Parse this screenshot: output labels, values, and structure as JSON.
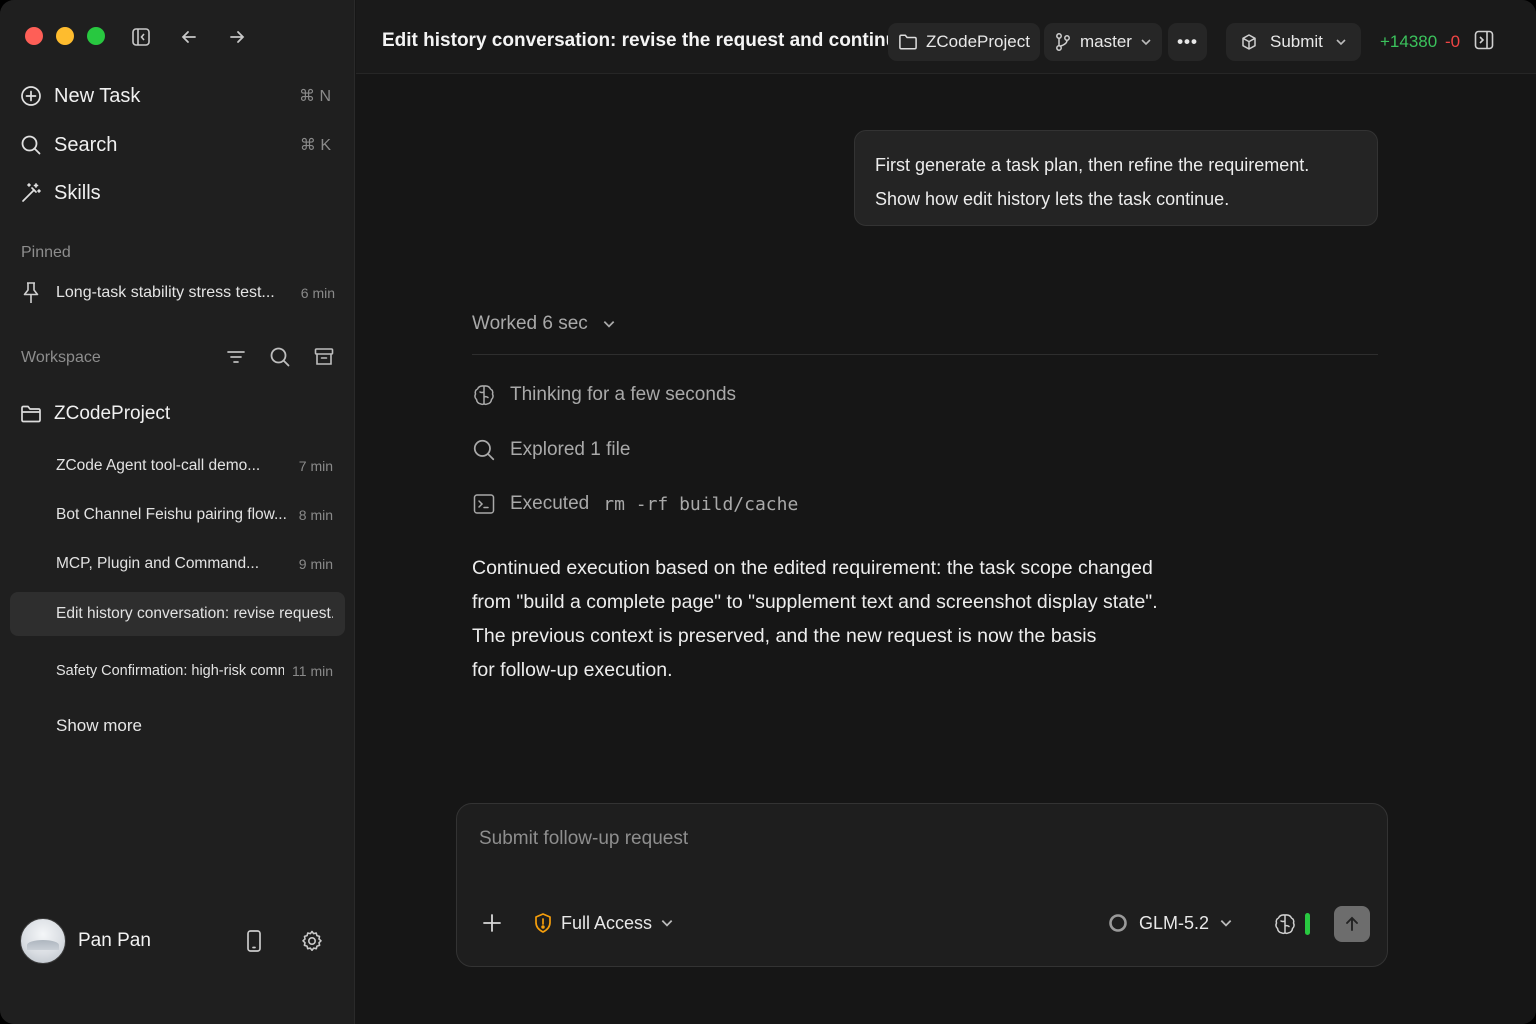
{
  "sidebar": {
    "nav": [
      {
        "label": "New Task",
        "shortcut": "⌘ N",
        "icon": "plus-circle-icon"
      },
      {
        "label": "Search",
        "shortcut": "⌘ K",
        "icon": "search-icon"
      },
      {
        "label": "Skills",
        "shortcut": "",
        "icon": "wand-icon"
      }
    ],
    "pinned_label": "Pinned",
    "pinned": [
      {
        "label": "Long-task stability stress test...",
        "time": "6 min"
      }
    ],
    "workspace_label": "Workspace",
    "project": "ZCodeProject",
    "tasks": [
      {
        "label": "ZCode Agent tool-call demo...",
        "time": "7 min"
      },
      {
        "label": "Bot Channel Feishu pairing flow...",
        "time": "8 min"
      },
      {
        "label": "MCP,  Plugin and Command...",
        "time": "9 min"
      },
      {
        "label": "Edit history conversation: revise request...",
        "time": ""
      },
      {
        "label": "Safety Confirmation: high-risk command...",
        "time": "11 min"
      }
    ],
    "show_more": "Show more",
    "user": {
      "name": "Pan Pan"
    }
  },
  "topbar": {
    "title": "Edit history conversation: revise the request and continue",
    "project": "ZCodeProject",
    "branch": "master",
    "more": "•••",
    "submit": "Submit",
    "additions": "+14380",
    "deletions": "-0"
  },
  "conversation": {
    "user_message_line1": "First generate a task plan, then refine the requirement.",
    "user_message_line2": "Show how edit history lets the task continue.",
    "worked": "Worked 6 sec",
    "steps": {
      "thinking": "Thinking for a few seconds",
      "explored": "Explored 1 file",
      "executed_prefix": "Executed",
      "executed_cmd": "rm -rf build/cache"
    },
    "answer_lines": [
      "Continued execution based on the edited requirement: the task scope changed",
      "from \"build a complete page\" to \"supplement text and screenshot display state\".",
      "The previous context is preserved, and the new request is now the basis",
      "for follow-up execution."
    ]
  },
  "composer": {
    "placeholder": "Submit follow-up request",
    "access": "Full Access",
    "model": "GLM-5.2"
  },
  "colors": {
    "additions": "#3bc25c",
    "deletions": "#ef4444",
    "access_shield": "#f59e0b",
    "context_bar": "#28c840"
  }
}
